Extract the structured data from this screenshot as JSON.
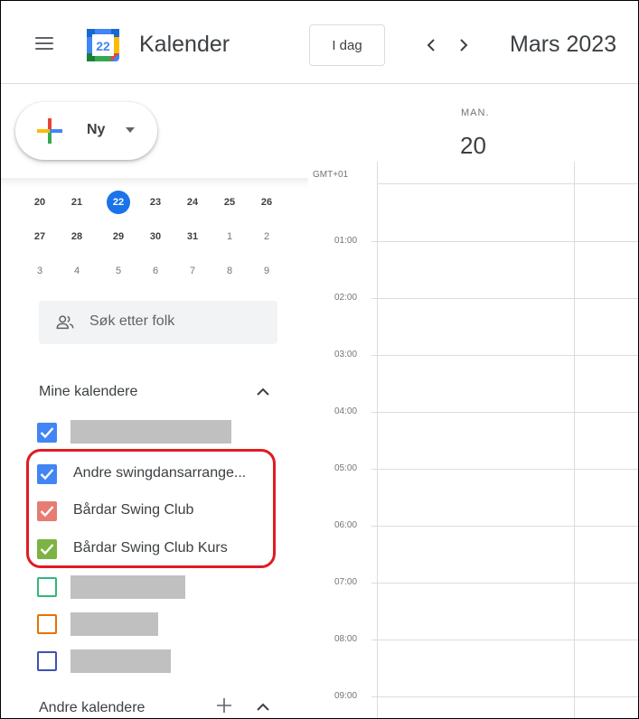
{
  "header": {
    "app_title": "Kalender",
    "logo_day": "22",
    "today_label": "I dag",
    "month_title": "Mars 2023",
    "icons": [
      "menu-icon",
      "calendar-logo",
      "chevron-left-icon",
      "chevron-right-icon"
    ]
  },
  "create": {
    "label": "Ny"
  },
  "mini_calendar": {
    "weeks": [
      [
        {
          "d": "20"
        },
        {
          "d": "21"
        },
        {
          "d": "22",
          "today": true
        },
        {
          "d": "23"
        },
        {
          "d": "24"
        },
        {
          "d": "25"
        },
        {
          "d": "26"
        }
      ],
      [
        {
          "d": "27"
        },
        {
          "d": "28"
        },
        {
          "d": "29"
        },
        {
          "d": "30"
        },
        {
          "d": "31"
        },
        {
          "d": "1",
          "muted": true
        },
        {
          "d": "2",
          "muted": true
        }
      ],
      [
        {
          "d": "3",
          "muted": true
        },
        {
          "d": "4",
          "muted": true
        },
        {
          "d": "5",
          "muted": true
        },
        {
          "d": "6",
          "muted": true
        },
        {
          "d": "7",
          "muted": true
        },
        {
          "d": "8",
          "muted": true
        },
        {
          "d": "9",
          "muted": true
        }
      ]
    ]
  },
  "people_search": {
    "placeholder": "Søk etter folk"
  },
  "my_calendars": {
    "title": "Mine kalendere",
    "items": [
      {
        "label": "",
        "redacted": true,
        "checked": true,
        "color": "#4285f4"
      },
      {
        "label": "Andre swingdansarrange...",
        "checked": true,
        "color": "#4285f4"
      },
      {
        "label": "Bårdar Swing Club",
        "checked": true,
        "color": "#e67c73"
      },
      {
        "label": "Bårdar Swing Club Kurs",
        "checked": true,
        "color": "#7cb342"
      },
      {
        "label": "",
        "redacted": true,
        "checked": false,
        "color": "#33b679"
      },
      {
        "label": "",
        "redacted": true,
        "checked": false,
        "color": "#e37400"
      },
      {
        "label": "",
        "redacted": true,
        "checked": false,
        "color": "#3f51b5"
      }
    ]
  },
  "other_calendars": {
    "title": "Andre kalendere"
  },
  "day_view": {
    "day_name": "MAN.",
    "day_number": "20",
    "timezone": "GMT+01",
    "hours": [
      "01:00",
      "02:00",
      "03:00",
      "04:00",
      "05:00",
      "06:00",
      "07:00",
      "08:00",
      "09:00"
    ]
  },
  "colors": {
    "accent": "#1a73e8",
    "highlight": "#e01b24"
  }
}
